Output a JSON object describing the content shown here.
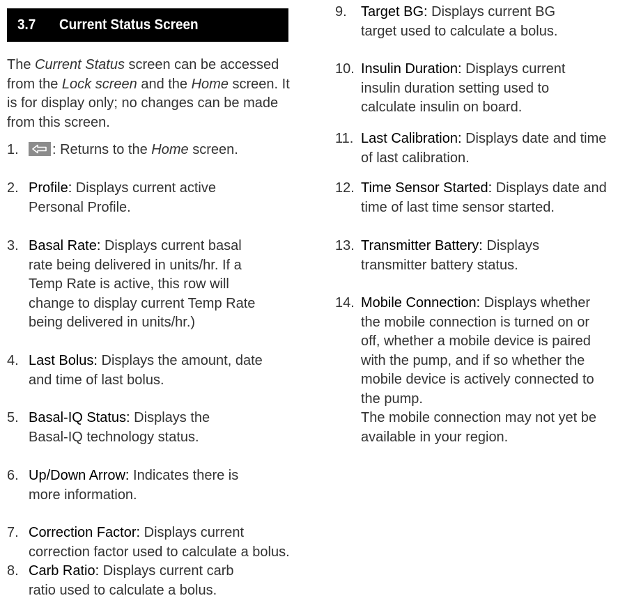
{
  "section": {
    "number": "3.7",
    "title": "Current Status Screen"
  },
  "intro": {
    "p1": "The ",
    "em1": "Current Status",
    "p2": " screen can be accessed from the ",
    "em2": "Lock screen",
    "p3": " and the ",
    "em3": "Home",
    "p4": " screen. It is for display only; no changes can be made from this screen."
  },
  "items": {
    "i1": {
      "num": "1.",
      "text": ": Returns to the ",
      "em": "Home",
      "tail": " screen.",
      "icon": "back-arrow-icon"
    },
    "i2": {
      "num": "2.",
      "term": "Profile:",
      "text": " Displays current active Personal Profile."
    },
    "i3": {
      "num": "3.",
      "term": "Basal Rate:",
      "text": " Displays current basal rate being delivered in units/hr. If a Temp Rate is active, this row will change to display current Temp Rate being delivered in units/hr.)"
    },
    "i4": {
      "num": "4.",
      "term": "Last Bolus:",
      "text": " Displays the amount, date and time of last bolus."
    },
    "i5": {
      "num": "5.",
      "term": "Basal-IQ Status:",
      "text": " Displays the Basal-IQ technology status."
    },
    "i6": {
      "num": "6.",
      "term": "Up/Down Arrow:",
      "text": " Indicates there is more information."
    },
    "i7": {
      "num": "7.",
      "term": "Correction Factor:",
      "text": " Displays current correction factor used to calculate a bolus."
    },
    "i8": {
      "num": "8.",
      "term": "Carb Ratio:",
      "text": " Displays current carb ratio used to calculate a bolus."
    },
    "i9": {
      "num": "9.",
      "term": "Target BG:",
      "text": " Displays current BG target used to calculate a bolus."
    },
    "i10": {
      "num": "10.",
      "term": "Insulin Duration:",
      "text": " Displays current insulin duration setting used to calculate insulin on board."
    },
    "i11": {
      "num": "11.",
      "term": "Last Calibration:",
      "text": " Displays date and time of last calibration."
    },
    "i12": {
      "num": "12.",
      "term": "Time Sensor Started:",
      "text": " Displays date and time of last time sensor started."
    },
    "i13": {
      "num": "13.",
      "term": "Transmitter Battery:",
      "text": " Displays transmitter battery status."
    },
    "i14": {
      "num": "14.",
      "term": "Mobile Connection:",
      "text": " Displays whether the mobile connection is turned on or off, whether a mobile device is paired with the pump, and if so whether the mobile device is actively connected to the pump."
    }
  },
  "note": "The mobile connection may not yet be available in your region."
}
